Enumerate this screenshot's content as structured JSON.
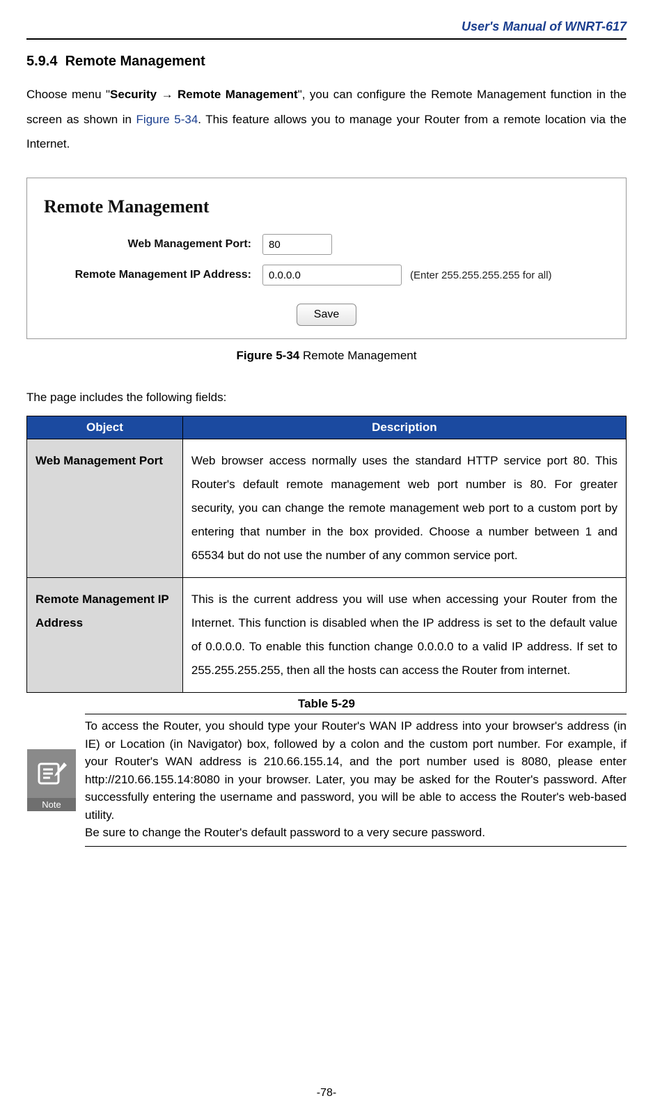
{
  "header": {
    "running_title": "User's Manual of WNRT-617"
  },
  "section": {
    "number_and_title": "5.9.4  Remote Management"
  },
  "intro": {
    "part1": "Choose menu \"",
    "bold": "Security → Remote Management",
    "part2": "\", you can configure the Remote Management function in the screen as shown in ",
    "figref": "Figure 5-34",
    "part3": ". This feature allows you to manage your Router from a remote location via the Internet."
  },
  "screenshot": {
    "title": "Remote Management",
    "rows": {
      "port_label": "Web Management Port:",
      "port_value": "80",
      "ip_label": "Remote Management IP Address:",
      "ip_value": "0.0.0.0",
      "ip_hint": "(Enter 255.255.255.255 for all)"
    },
    "save_label": "Save"
  },
  "figure_caption": {
    "bold": "Figure 5-34",
    "rest": " Remote Management"
  },
  "fields_lead": "The page includes the following fields:",
  "table": {
    "head_object": "Object",
    "head_desc": "Description",
    "rows": [
      {
        "object": "Web Management Port",
        "desc": "Web browser access normally uses the standard HTTP service port 80. This Router's default remote management web port number is 80. For greater security, you can change the remote management web port to a custom port by entering that number in the box provided. Choose a number between 1 and 65534 but do not use the number of any common service port."
      },
      {
        "object": "Remote Management IP Address",
        "desc": "This is the current address you will use when accessing your Router from the Internet. This function is disabled when the IP address is set to the default value of 0.0.0.0. To enable this function change 0.0.0.0 to a valid IP address. If set to 255.255.255.255, then all the hosts can access the Router from internet."
      }
    ]
  },
  "table_caption": "Table 5-29",
  "note": {
    "icon_label": "Note",
    "text_line1": "To access the Router, you should type your Router's WAN IP address into your browser's address (in IE) or Location (in Navigator) box, followed by a colon and the custom port number. For example, if your Router's WAN address is 210.66.155.14, and the port number used is 8080, please enter http://210.66.155.14:8080 in your browser. Later, you may be asked for the Router's password. After successfully entering the username and password, you will be able to access the Router's web-based utility.",
    "text_line2": "Be sure to change the Router's default password to a very secure password."
  },
  "page_number": "-78-"
}
